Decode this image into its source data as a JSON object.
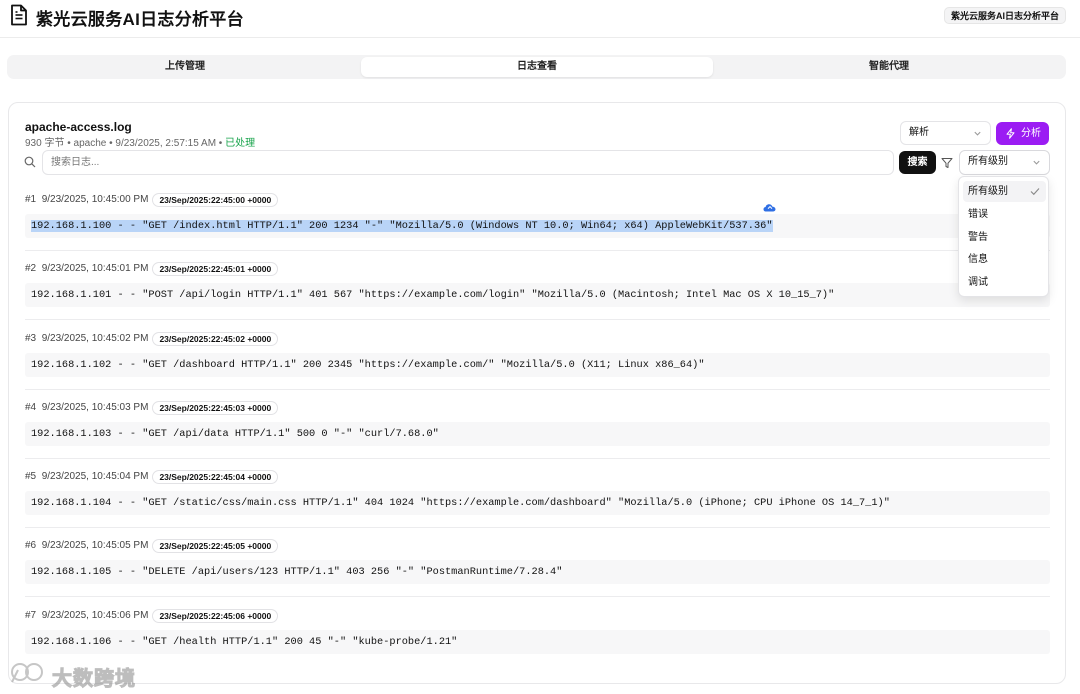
{
  "header": {
    "title": "紫光云服务AI日志分析平台",
    "badge": "紫光云服务AI日志分析平台",
    "icon": "document-icon"
  },
  "tabs": [
    {
      "label": "上传管理",
      "active": false
    },
    {
      "label": "日志查看",
      "active": true
    },
    {
      "label": "智能代理",
      "active": false
    }
  ],
  "file": {
    "name": "apache-access.log",
    "meta": "930 字节 • apache • 9/23/2025, 2:57:15 AM • ",
    "status": "已处理"
  },
  "toolbar": {
    "parse_select_value": "解析",
    "analyze_label": "分析",
    "search_placeholder": "搜索日志...",
    "search_button": "搜索",
    "level_select_value": "所有级别"
  },
  "level_menu": {
    "options": [
      "所有级别",
      "错误",
      "警告",
      "信息",
      "调试"
    ],
    "selected": "所有级别"
  },
  "entries": [
    {
      "index": "#1",
      "time": "9/23/2025, 10:45:00 PM",
      "badge": "23/Sep/2025:22:45:00 +0000",
      "line": "192.168.1.100 - - \"GET /index.html HTTP/1.1\" 200 1234 \"-\" \"Mozilla/5.0 (Windows NT 10.0; Win64; x64) AppleWebKit/537.36\"",
      "selected": true
    },
    {
      "index": "#2",
      "time": "9/23/2025, 10:45:01 PM",
      "badge": "23/Sep/2025:22:45:01 +0000",
      "line": "192.168.1.101 - - \"POST /api/login HTTP/1.1\" 401 567 \"https://example.com/login\" \"Mozilla/5.0 (Macintosh; Intel Mac OS X 10_15_7)\"",
      "selected": false
    },
    {
      "index": "#3",
      "time": "9/23/2025, 10:45:02 PM",
      "badge": "23/Sep/2025:22:45:02 +0000",
      "line": "192.168.1.102 - - \"GET /dashboard HTTP/1.1\" 200 2345 \"https://example.com/\" \"Mozilla/5.0 (X11; Linux x86_64)\"",
      "selected": false
    },
    {
      "index": "#4",
      "time": "9/23/2025, 10:45:03 PM",
      "badge": "23/Sep/2025:22:45:03 +0000",
      "line": "192.168.1.103 - - \"GET /api/data HTTP/1.1\" 500 0 \"-\" \"curl/7.68.0\"",
      "selected": false
    },
    {
      "index": "#5",
      "time": "9/23/2025, 10:45:04 PM",
      "badge": "23/Sep/2025:22:45:04 +0000",
      "line": "192.168.1.104 - - \"GET /static/css/main.css HTTP/1.1\" 404 1024 \"https://example.com/dashboard\" \"Mozilla/5.0 (iPhone; CPU iPhone OS 14_7_1)\"",
      "selected": false
    },
    {
      "index": "#6",
      "time": "9/23/2025, 10:45:05 PM",
      "badge": "23/Sep/2025:22:45:05 +0000",
      "line": "192.168.1.105 - - \"DELETE /api/users/123 HTTP/1.1\" 403 256 \"-\" \"PostmanRuntime/7.28.4\"",
      "selected": false
    },
    {
      "index": "#7",
      "time": "9/23/2025, 10:45:06 PM",
      "badge": "23/Sep/2025:22:45:06 +0000",
      "line": "192.168.1.106 - - \"GET /health HTTP/1.1\" 200 45 \"-\" \"kube-probe/1.21\"",
      "selected": false
    }
  ],
  "watermark": {
    "text": "大数跨境"
  },
  "colors": {
    "accent": "#9b1cf3",
    "success": "#16a34a",
    "selection": "#b9d4f7"
  }
}
